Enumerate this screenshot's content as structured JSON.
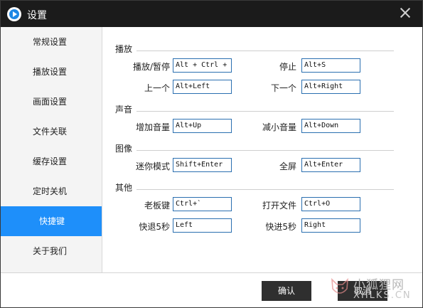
{
  "window": {
    "title": "设置"
  },
  "sidebar": {
    "items": [
      {
        "label": "常规设置"
      },
      {
        "label": "播放设置"
      },
      {
        "label": "画面设置"
      },
      {
        "label": "文件关联"
      },
      {
        "label": "缓存设置"
      },
      {
        "label": "定时关机"
      },
      {
        "label": "快捷键",
        "active": true
      },
      {
        "label": "关于我们"
      }
    ]
  },
  "sections": {
    "playback": {
      "title": "播放",
      "play_pause": {
        "label": "播放/暂停",
        "value": "Alt + Ctrl +"
      },
      "stop": {
        "label": "停止",
        "value": "Alt+S"
      },
      "prev": {
        "label": "上一个",
        "value": "Alt+Left"
      },
      "next": {
        "label": "下一个",
        "value": "Alt+Right"
      }
    },
    "sound": {
      "title": "声音",
      "vol_up": {
        "label": "增加音量",
        "value": "Alt+Up"
      },
      "vol_down": {
        "label": "减小音量",
        "value": "Alt+Down"
      }
    },
    "image": {
      "title": "图像",
      "mini": {
        "label": "迷你模式",
        "value": "Shift+Enter"
      },
      "fullscreen": {
        "label": "全屏",
        "value": "Alt+Enter"
      }
    },
    "other": {
      "title": "其他",
      "boss": {
        "label": "老板键",
        "value": "Ctrl+`"
      },
      "open": {
        "label": "打开文件",
        "value": "Ctrl+O"
      },
      "rewind": {
        "label": "快退5秒",
        "value": "Left"
      },
      "forward": {
        "label": "快进5秒",
        "value": "Right"
      }
    }
  },
  "footer": {
    "confirm": "确认",
    "cancel": "取消"
  },
  "watermark": {
    "text_cn": "小狐狸网",
    "text_en": "XHLKS.CN",
    "icon": "fox-logo-icon"
  },
  "colors": {
    "titlebar": "#1b1b1b",
    "accent": "#1e8ffa",
    "button": "#2f2f2f",
    "field_border": "#2a6fb0"
  }
}
